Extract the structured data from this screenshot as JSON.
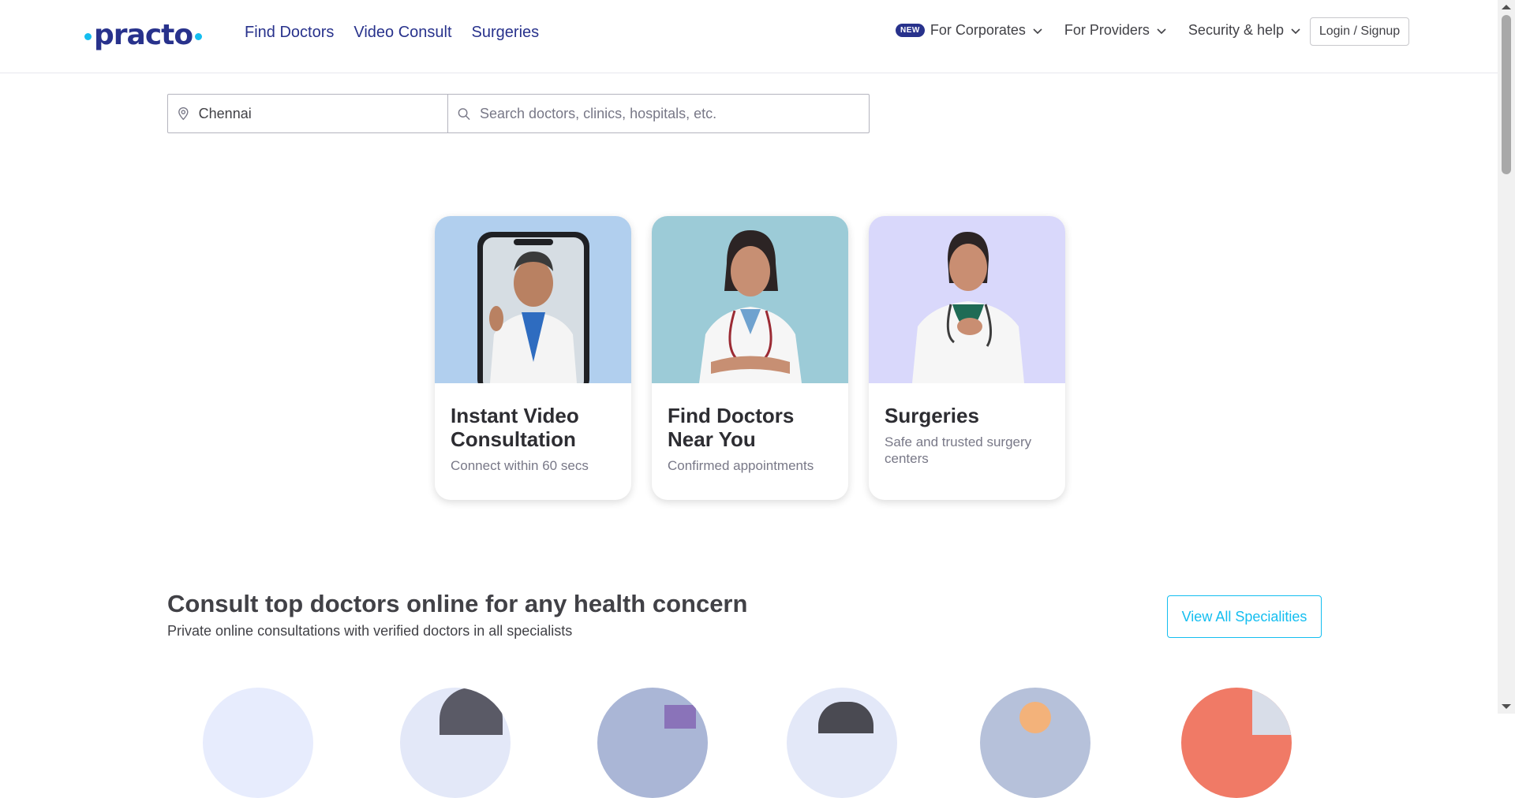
{
  "header": {
    "logo_text": "practo",
    "nav_main": [
      "Find Doctors",
      "Video Consult",
      "Surgeries"
    ],
    "nav_right": [
      {
        "badge": "NEW",
        "label": "For Corporates"
      },
      {
        "label": "For Providers"
      },
      {
        "label": "Security & help"
      }
    ],
    "login_label": "Login / Signup"
  },
  "search": {
    "location_value": "Chennai",
    "query_placeholder": "Search doctors, clinics, hospitals, etc."
  },
  "cards": [
    {
      "title": "Instant Video Consultation",
      "subtitle": "Connect within 60 secs",
      "bg_color": "#b1cfee"
    },
    {
      "title": "Find Doctors Near You",
      "subtitle": "Confirmed appointments",
      "bg_color": "#9ccbd7"
    },
    {
      "title": "Surgeries",
      "subtitle": "Safe and trusted surgery centers",
      "bg_color": "#d9d8fb"
    }
  ],
  "section": {
    "title": "Consult top doctors online for any health concern",
    "subtitle": "Private online consultations with verified doctors in all specialists",
    "view_all_label": "View All Specialities"
  },
  "colors": {
    "brand_navy": "#28328c",
    "brand_cyan": "#14bef0"
  }
}
